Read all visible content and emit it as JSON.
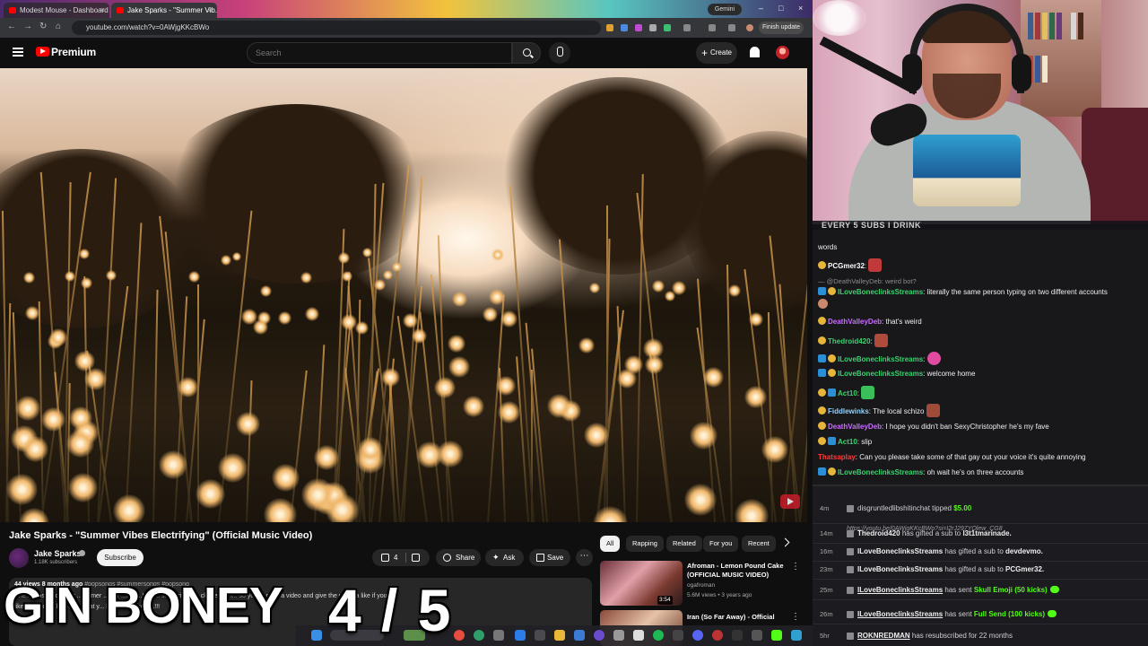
{
  "browser": {
    "tabs": [
      {
        "label": "Modest Mouse - Dashboard |"
      },
      {
        "label": "Jake Sparks - \"Summer Vib..."
      }
    ],
    "gemini_label": "Gemini",
    "url": "youtube.com/watch?v=0AWjgKKcBWo",
    "finish_update_label": "Finish update"
  },
  "youtube": {
    "brand": "Premium",
    "search_placeholder": "Search",
    "create_label": "Create"
  },
  "video": {
    "title": "Jake Sparks - \"Summer Vibes Electrifying\" (Official Music Video)",
    "channel": "Jake Sparks",
    "subscribers": "1.18K subscribers",
    "subscribe_label": "Subscribe",
    "likes": "4",
    "share_label": "Share",
    "ask_label": "Ask",
    "save_label": "Save",
    "views_date": "44 views  8 months ago",
    "hashtags": "#popsongs #summersongs #popsong",
    "desc_line1": "Che... music video for ...ummer ...mer ...ebe...!!! Pl... subscribe a... ck the bell i... so you ... miss a video and give the video a like if you",
    "desc_line2": "like it and ch... below ... what y... ll ... S... in the n...!!!"
  },
  "chips": [
    "All",
    "Rapping",
    "Related",
    "For you",
    "Recent"
  ],
  "recommendations": [
    {
      "title": "Afroman - Lemon Pound Cake (OFFICIAL MUSIC VIDEO)",
      "channel": "ogafroman",
      "meta": "5.6M views • 3 years ago",
      "duration": "3:54"
    },
    {
      "title": "Iran (So Far Away) - Official"
    }
  ],
  "overlay": {
    "text": "GIN BONEY",
    "counter": "4 / 5"
  },
  "taskbar": {
    "search": "S"
  },
  "webcam": {
    "banner": "EVERY 5 SUBS I DRINK"
  },
  "chat": [
    {
      "text": "words"
    },
    {
      "user": "PCGmer32",
      "color": "#ffffff",
      "text": ":"
    },
    {
      "reply": "@DeathValleyDeb: weird bot?"
    },
    {
      "user": "ILoveBoneclinksStreams",
      "color": "#3bd16f",
      "text": ": literally the same person typing on two different accounts"
    },
    {
      "user": "DeathValleyDeb",
      "color": "#c86dff",
      "text": ": that's weird"
    },
    {
      "user": "Thedroid420",
      "color": "#3bd16f",
      "text": ":"
    },
    {
      "user": "ILoveBoneclinksStreams",
      "color": "#3bd16f",
      "text": ":"
    },
    {
      "user": "ILoveBoneclinksStreams",
      "color": "#3bd16f",
      "text": ": welcome home"
    },
    {
      "user": "Act10",
      "color": "#3bd16f",
      "text": ":"
    },
    {
      "user": "Fiddlewinks",
      "color": "#8fd3ff",
      "text": ": The local schizo"
    },
    {
      "user": "DeathValleyDeb",
      "color": "#c86dff",
      "text": ": I hope you didn't ban SexyChristopher he's my fave"
    },
    {
      "user": "Act10",
      "color": "#3bd16f",
      "text": ": slip"
    },
    {
      "user": "Thatsaplay",
      "color": "#ff3b3b",
      "text": ": Can you please take some of that gay out your voice it's quite annoying"
    },
    {
      "user": "ILoveBoneclinksStreams",
      "color": "#3bd16f",
      "text": ": oh wait he's on three accounts"
    }
  ],
  "events": [
    {
      "time": "4m",
      "user": "disgruntledlibshitinchat",
      "action": "tipped",
      "amount": "$5.00",
      "link": "https://youtu.be/0AWjgKKcBWo?si=I2rJ297YOlew_CG8"
    },
    {
      "time": "14m",
      "user": "Thedroid420",
      "action": "has gifted a sub to",
      "target": "l3t1tmarinade."
    },
    {
      "time": "16m",
      "user": "ILoveBoneclinksStreams",
      "action": "has gifted a sub to",
      "target": "devdevmo."
    },
    {
      "time": "23m",
      "user": "ILoveBoneclinksStreams",
      "action": "has gifted a sub to",
      "target": "PCGmer32."
    },
    {
      "time": "25m",
      "user": "ILoveBoneclinksStreams",
      "action": "has sent",
      "kick": "Skull Emoji (50 kicks)"
    },
    {
      "time": "26m",
      "user": "ILoveBoneclinksStreams",
      "action": "has sent",
      "kick": "Full Send (100 kicks)"
    },
    {
      "time": "5hr",
      "user": "ROKNREDMAN",
      "action": "has resubscribed for 22 months"
    }
  ],
  "colors": {
    "kick_green": "#53fc18",
    "yt_red": "#ff0000",
    "chat_bg": "#18181b"
  }
}
